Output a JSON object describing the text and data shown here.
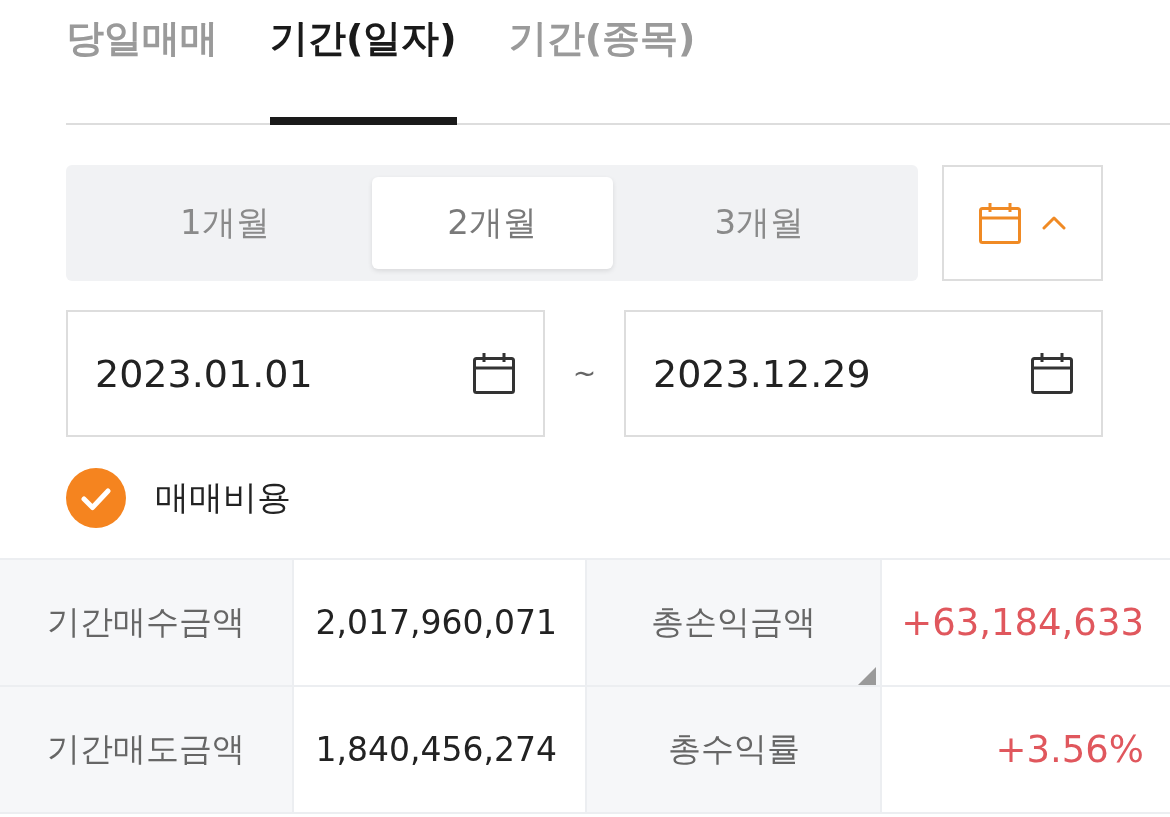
{
  "tabs": [
    {
      "label": "당일매매",
      "selected": false
    },
    {
      "label": "기간(일자)",
      "selected": true
    },
    {
      "label": "기간(종목)",
      "selected": false
    }
  ],
  "period_options": [
    {
      "label": "1개월",
      "selected": false
    },
    {
      "label": "2개월",
      "selected": true
    },
    {
      "label": "3개월",
      "selected": false
    }
  ],
  "calendar_toggle": {
    "expanded": true
  },
  "date_range": {
    "start": "2023.01.01",
    "separator": "~",
    "end": "2023.12.29"
  },
  "trading_cost": {
    "label": "매매비용",
    "checked": true
  },
  "summary": {
    "rows": [
      {
        "cells": [
          {
            "kind": "label",
            "text": "기간매수금액",
            "corner_mark": false
          },
          {
            "kind": "amount",
            "text": "2,017,960,071",
            "corner_mark": false
          },
          {
            "kind": "label",
            "text": "총손익금액",
            "corner_mark": true
          },
          {
            "kind": "gain",
            "text": "+63,184,633",
            "corner_mark": false
          }
        ]
      },
      {
        "cells": [
          {
            "kind": "label",
            "text": "기간매도금액",
            "corner_mark": false
          },
          {
            "kind": "amount",
            "text": "1,840,456,274",
            "corner_mark": false
          },
          {
            "kind": "label",
            "text": "총수익률",
            "corner_mark": false
          },
          {
            "kind": "gain",
            "text": "+3.56%",
            "corner_mark": false
          }
        ]
      }
    ]
  }
}
